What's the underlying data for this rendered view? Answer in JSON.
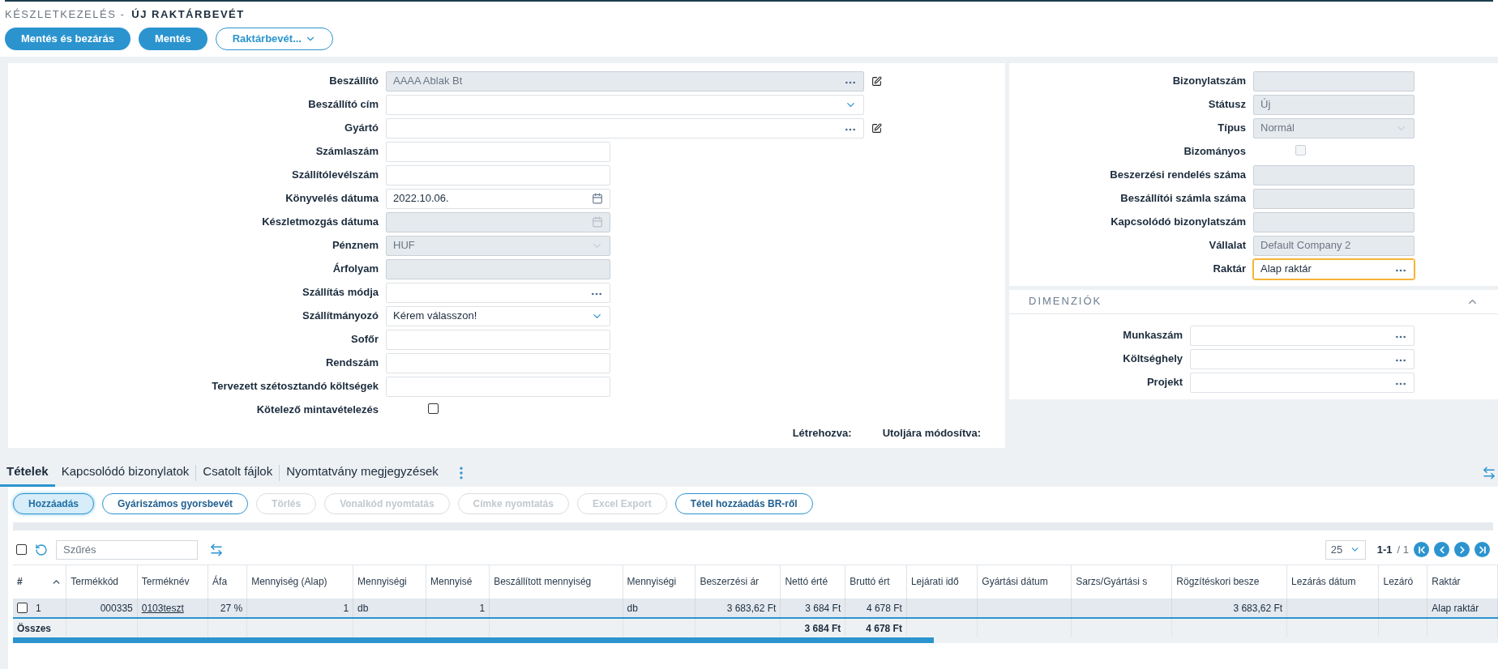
{
  "breadcrumb": {
    "module": "KÉSZLETKEZELÉS -",
    "page": "ÚJ RAKTÁRBEVÉT"
  },
  "actions": [
    {
      "label": "Mentés és bezárás",
      "kind": "primary"
    },
    {
      "label": "Mentés",
      "kind": "primary"
    },
    {
      "label": "Raktárbevét...",
      "kind": "dropdown"
    }
  ],
  "main_form": {
    "wide_fields": [
      {
        "label": "Beszállító",
        "kind": "lookup",
        "value": "AAAA Ablak Bt",
        "disabled": true,
        "edit": true
      },
      {
        "label": "Beszállító cím",
        "kind": "select",
        "disabled": false,
        "edit": false
      },
      {
        "label": "Gyártó",
        "kind": "lookup",
        "disabled": false,
        "edit": true
      }
    ],
    "fields": [
      {
        "label": "Számlaszám",
        "kind": "text",
        "disabled": false
      },
      {
        "label": "Szállítólevélszám",
        "kind": "text",
        "disabled": false
      },
      {
        "label": "Könyvelés dátuma",
        "kind": "date",
        "value": "2022.10.06.",
        "disabled": false
      },
      {
        "label": "Készletmozgás dátuma",
        "kind": "date",
        "disabled": true
      },
      {
        "label": "Pénznem",
        "kind": "select",
        "value": "HUF",
        "disabled": true
      },
      {
        "label": "Árfolyam",
        "kind": "text",
        "disabled": true
      },
      {
        "label": "Szállítás módja",
        "kind": "lookup",
        "disabled": false
      },
      {
        "label": "Szállítmányozó",
        "kind": "select",
        "value": "Kérem válasszon!",
        "disabled": false
      },
      {
        "label": "Sofőr",
        "kind": "text",
        "disabled": false
      },
      {
        "label": "Rendszám",
        "kind": "text",
        "disabled": false
      },
      {
        "label": "Tervezett szétosztandó költségek",
        "kind": "text",
        "disabled": false
      },
      {
        "label": "Kötelező mintavételezés",
        "kind": "checkbox",
        "checked": false,
        "disabled": false
      }
    ],
    "created_label": "Létrehozva:",
    "modified_label": "Utoljára módosítva:"
  },
  "header_form": {
    "fields": [
      {
        "label": "Bizonylatszám",
        "kind": "text",
        "disabled": true,
        "focused": false
      },
      {
        "label": "Státusz",
        "kind": "text",
        "value": "Új",
        "disabled": true,
        "focused": false
      },
      {
        "label": "Típus",
        "kind": "select",
        "value": "Normál",
        "disabled": true,
        "focused": false
      },
      {
        "label": "Bizományos",
        "kind": "checkbox",
        "checked": false,
        "disabled": true,
        "focused": false
      },
      {
        "label": "Beszerzési rendelés száma",
        "kind": "text",
        "disabled": true,
        "focused": false
      },
      {
        "label": "Beszállítói számla száma",
        "kind": "text",
        "disabled": true,
        "focused": false
      },
      {
        "label": "Kapcsolódó bizonylatszám",
        "kind": "text",
        "disabled": true,
        "focused": false
      },
      {
        "label": "Vállalat",
        "kind": "text",
        "value": "Default Company 2",
        "disabled": true,
        "focused": false
      },
      {
        "label": "Raktár",
        "kind": "lookup",
        "value": "Alap raktár",
        "disabled": false,
        "focused": true
      }
    ]
  },
  "dimensions": {
    "title": "DIMENZIÓK",
    "expanded": true,
    "fields": [
      {
        "label": "Munkaszám",
        "kind": "lookup",
        "disabled": false
      },
      {
        "label": "Költséghely",
        "kind": "lookup",
        "disabled": false
      },
      {
        "label": "Projekt",
        "kind": "lookup",
        "disabled": false
      }
    ]
  },
  "tabs": [
    {
      "label": "Tételek",
      "selected": true
    },
    {
      "label": "Kapcsolódó bizonylatok",
      "selected": false
    },
    {
      "label": "Csatolt fájlok",
      "selected": false
    },
    {
      "label": "Nyomtatvány megjegyzések",
      "selected": false
    }
  ],
  "toolbar": [
    {
      "label": "Hozzáadás",
      "disabled": false,
      "selected": true
    },
    {
      "label": "Gyáriszámos gyorsbevét",
      "disabled": false,
      "selected": false
    },
    {
      "label": "Törlés",
      "disabled": true,
      "selected": false
    },
    {
      "label": "Vonalkód nyomtatás",
      "disabled": true,
      "selected": false
    },
    {
      "label": "Címke nyomtatás",
      "disabled": true,
      "selected": false
    },
    {
      "label": "Excel Export",
      "disabled": true,
      "selected": false
    },
    {
      "label": "Tétel hozzáadás BR-ről",
      "disabled": false,
      "selected": false
    }
  ],
  "grid": {
    "filter_placeholder": "Szűrés",
    "select_all": false,
    "page_size": "25",
    "page_range": "1-1",
    "page_total": "/ 1",
    "columns": [
      {
        "label": "#",
        "kind": "index",
        "total": "Összes"
      },
      {
        "label": "Termékkód",
        "kind": "number"
      },
      {
        "label": "Terméknév",
        "kind": "link"
      },
      {
        "label": "Áfa",
        "kind": "number"
      },
      {
        "label": "Mennyiség (Alap)",
        "kind": "number"
      },
      {
        "label": "Mennyiségi",
        "kind": "text"
      },
      {
        "label": "Mennyisé",
        "kind": "number"
      },
      {
        "label": "Beszállított mennyiség",
        "kind": "number"
      },
      {
        "label": "Mennyiségi",
        "kind": "text"
      },
      {
        "label": "Beszerzési ár",
        "kind": "number"
      },
      {
        "label": "Nettó érté",
        "kind": "number",
        "total": "3 684 Ft"
      },
      {
        "label": "Bruttó ért",
        "kind": "number",
        "total": "4 678 Ft"
      },
      {
        "label": "Lejárati idő",
        "kind": "text"
      },
      {
        "label": "Gyártási dátum",
        "kind": "text"
      },
      {
        "label": "Sarzs/Gyártási s",
        "kind": "text"
      },
      {
        "label": "Rögzítéskori besze",
        "kind": "number"
      },
      {
        "label": "Lezárás dátum",
        "kind": "text"
      },
      {
        "label": "Lezáró",
        "kind": "text"
      },
      {
        "label": "Raktár",
        "kind": "text"
      }
    ],
    "rows": [
      {
        "checked": false,
        "cells": {
          "0": "1",
          "1": "000335",
          "2": "0103teszt",
          "3": "27 %",
          "4": "1",
          "5": "db",
          "6": "1",
          "8": "db",
          "9": "3 683,62 Ft",
          "10": "3 684 Ft",
          "11": "4 678 Ft",
          "15": "3 683,62 Ft",
          "18": "Alap raktár"
        }
      }
    ]
  }
}
